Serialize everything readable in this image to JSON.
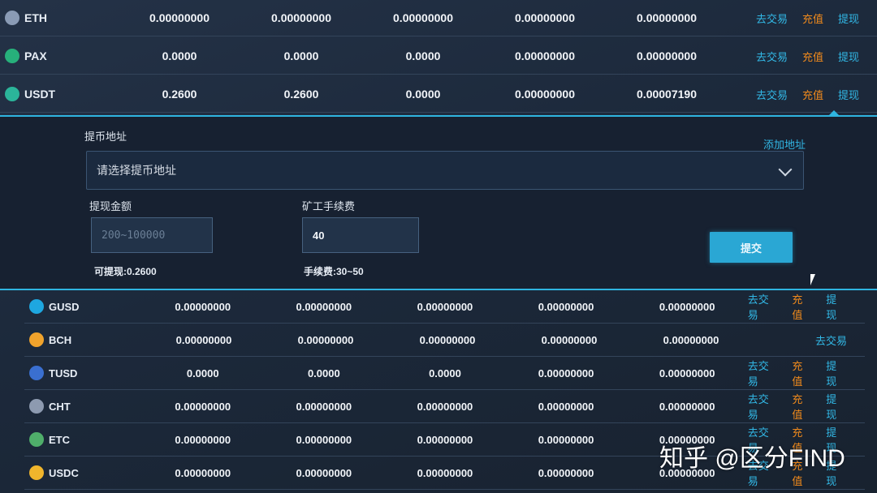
{
  "assets_top": [
    {
      "coin": "ETH",
      "icon": "ethereum-icon",
      "color": "#8a9bb5",
      "values": [
        "0.00000000",
        "0.00000000",
        "0.00000000",
        "0.00000000",
        "0.00000000"
      ],
      "actions": {
        "trade": "去交易",
        "deposit": "充值",
        "withdraw": "提现"
      }
    },
    {
      "coin": "PAX",
      "icon": "pax-icon",
      "color": "#27b07b",
      "values": [
        "0.0000",
        "0.0000",
        "0.0000",
        "0.00000000",
        "0.00000000"
      ],
      "actions": {
        "trade": "去交易",
        "deposit": "充值",
        "withdraw": "提现"
      }
    },
    {
      "coin": "USDT",
      "icon": "tether-icon",
      "color": "#2bb59a",
      "values": [
        "0.2600",
        "0.2600",
        "0.0000",
        "0.00000000",
        "0.00007190"
      ],
      "actions": {
        "trade": "去交易",
        "deposit": "充值",
        "withdraw": "提现"
      }
    }
  ],
  "withdraw_panel": {
    "address_label": "提币地址",
    "add_address_link": "添加地址",
    "address_placeholder": "请选择提币地址",
    "amount_label": "提现金额",
    "amount_placeholder": "200~100000",
    "fee_label": "矿工手续费",
    "fee_value": "40",
    "available": "可提现:0.2600",
    "fee_range": "手续费:30~50",
    "submit_label": "提交"
  },
  "assets_bottom": [
    {
      "coin": "GUSD",
      "icon": "gusd-icon",
      "color": "#1ea7e0",
      "values": [
        "0.00000000",
        "0.00000000",
        "0.00000000",
        "0.00000000",
        "0.00000000"
      ],
      "actions": {
        "trade": "去交易",
        "deposit": "充值",
        "withdraw": "提现"
      }
    },
    {
      "coin": "BCH",
      "icon": "bitcoin-cash-icon",
      "color": "#f0a32c",
      "values": [
        "0.00000000",
        "0.00000000",
        "0.00000000",
        "0.00000000",
        "0.00000000"
      ],
      "actions": {
        "trade": "去交易"
      }
    },
    {
      "coin": "TUSD",
      "icon": "tusd-icon",
      "color": "#3a6fd0",
      "values": [
        "0.0000",
        "0.0000",
        "0.0000",
        "0.00000000",
        "0.00000000"
      ],
      "actions": {
        "trade": "去交易",
        "deposit": "充值",
        "withdraw": "提现"
      }
    },
    {
      "coin": "CHT",
      "icon": "cht-icon",
      "color": "#8d9ab0",
      "values": [
        "0.00000000",
        "0.00000000",
        "0.00000000",
        "0.00000000",
        "0.00000000"
      ],
      "actions": {
        "trade": "去交易",
        "deposit": "充值",
        "withdraw": "提现"
      }
    },
    {
      "coin": "ETC",
      "icon": "ethereum-classic-icon",
      "color": "#4fae6a",
      "values": [
        "0.00000000",
        "0.00000000",
        "0.00000000",
        "0.00000000",
        "0.00000000"
      ],
      "actions": {
        "trade": "去交易",
        "deposit": "充值",
        "withdraw": "提现"
      }
    },
    {
      "coin": "USDC",
      "icon": "usdc-icon",
      "color": "#f0b52c",
      "values": [
        "0.00000000",
        "0.00000000",
        "0.00000000",
        "0.00000000",
        "0.00000000"
      ],
      "actions": {
        "trade": "去交易",
        "deposit": "充值",
        "withdraw": "提现"
      }
    }
  ],
  "watermark": "知乎 @区分FIND"
}
